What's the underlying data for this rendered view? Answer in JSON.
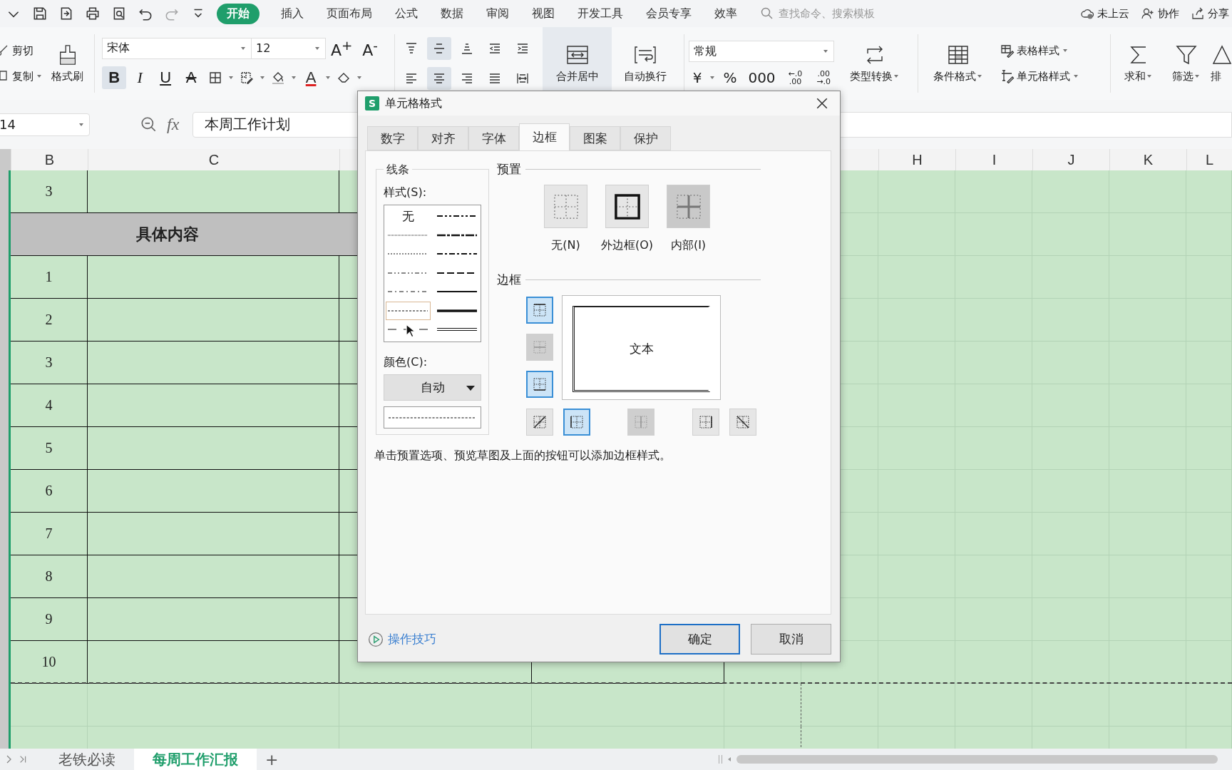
{
  "quick_access": [
    {
      "kind": "chevron",
      "disabled": false
    },
    {
      "kind": "save",
      "disabled": false
    },
    {
      "kind": "export",
      "disabled": false
    },
    {
      "kind": "print",
      "disabled": false
    },
    {
      "kind": "preview",
      "disabled": false
    },
    {
      "kind": "undo",
      "disabled": false
    },
    {
      "kind": "redo",
      "disabled": true
    },
    {
      "kind": "more",
      "disabled": false
    }
  ],
  "menu_tabs": [
    {
      "label": "开始",
      "selected": true
    },
    {
      "label": "插入",
      "selected": false
    },
    {
      "label": "页面布局",
      "selected": false
    },
    {
      "label": "公式",
      "selected": false
    },
    {
      "label": "数据",
      "selected": false
    },
    {
      "label": "审阅",
      "selected": false
    },
    {
      "label": "视图",
      "selected": false
    },
    {
      "label": "开发工具",
      "selected": false
    },
    {
      "label": "会员专享",
      "selected": false
    },
    {
      "label": "效率",
      "selected": false
    }
  ],
  "search": {
    "placeholder": "查找命令、搜索模板"
  },
  "top_actions": [
    {
      "kind": "cloud",
      "label": "未上云"
    },
    {
      "kind": "person",
      "label": "协作"
    },
    {
      "kind": "share",
      "label": "分享"
    }
  ],
  "ribbon": {
    "clipboard": [
      {
        "kind": "cut",
        "label": "剪切"
      },
      {
        "kind": "copy",
        "label": "复制"
      }
    ],
    "painter": "格式刷",
    "font_family": "宋体",
    "font_size": "12",
    "size_buttons": [
      "A$^{+}$",
      "A$^{-}$"
    ],
    "font_tools": [
      {
        "kind": "bold",
        "label": "B",
        "on": true
      },
      {
        "kind": "italic",
        "label": "I",
        "on": false
      },
      {
        "kind": "underline",
        "label": "U",
        "on": false
      },
      {
        "kind": "strike",
        "label": "A",
        "on": false
      },
      {
        "kind": "borders",
        "on": false
      },
      {
        "kind": "cellstyle",
        "on": false
      },
      {
        "kind": "fill",
        "on": false
      },
      {
        "kind": "fontcolor",
        "label": "A",
        "on": false
      },
      {
        "kind": "eraser",
        "on": false
      }
    ],
    "align_rows": [
      [
        {
          "kind": "top",
          "on": false
        },
        {
          "kind": "middle",
          "on": true
        },
        {
          "kind": "bottom",
          "on": false
        },
        {
          "kind": "outdent",
          "on": false
        },
        {
          "kind": "indent",
          "on": false
        }
      ],
      [
        {
          "kind": "left",
          "on": false
        },
        {
          "kind": "center",
          "on": true
        },
        {
          "kind": "right",
          "on": false
        },
        {
          "kind": "justify",
          "on": false
        },
        {
          "kind": "distribute",
          "on": false
        }
      ]
    ],
    "merge": {
      "label": "合并居中",
      "on": true
    },
    "wrap": "自动换行",
    "number_format": "常规",
    "number_tools": [
      {
        "kind": "text",
        "label": "¥"
      },
      {
        "kind": "text",
        "label": "%"
      },
      {
        "kind": "text",
        "label": "000"
      },
      {
        "kind": "decimal",
        "top": "←.0",
        "bottom": ".00"
      },
      {
        "kind": "decimal",
        "top": ".00",
        "bottom": "→.0"
      }
    ],
    "convert": "类型转换",
    "conditional": "条件格式",
    "styles": [
      {
        "kind": "table",
        "label": "表格样式"
      },
      {
        "kind": "cell",
        "label": "单元格样式"
      }
    ],
    "sum": "求和",
    "filter": "筛选",
    "sort": "排"
  },
  "formula_bar": {
    "name_box": "14",
    "fx": "fx",
    "value": "本周工作计划"
  },
  "col_headers": [
    "B",
    "C",
    "H",
    "I",
    "J",
    "K",
    "L"
  ],
  "rows": [
    {
      "kind": "number",
      "value": "3"
    },
    {
      "kind": "section",
      "title": "具体内容"
    },
    {
      "kind": "number",
      "value": "1"
    },
    {
      "kind": "number",
      "value": "2"
    },
    {
      "kind": "number",
      "value": "3"
    },
    {
      "kind": "number",
      "value": "4"
    },
    {
      "kind": "number",
      "value": "5"
    },
    {
      "kind": "number",
      "value": "6"
    },
    {
      "kind": "number",
      "value": "7"
    },
    {
      "kind": "number",
      "value": "8"
    },
    {
      "kind": "number",
      "value": "9"
    },
    {
      "kind": "number",
      "value": "10"
    }
  ],
  "dialog": {
    "icon_label": "S",
    "title": "单元格格式",
    "tabs": [
      {
        "label": "数字",
        "selected": false
      },
      {
        "label": "对齐",
        "selected": false
      },
      {
        "label": "字体",
        "selected": false
      },
      {
        "label": "边框",
        "selected": true
      },
      {
        "label": "图案",
        "selected": false
      },
      {
        "label": "保护",
        "selected": false
      }
    ],
    "line_group": "线条",
    "style_label": "样式(S):",
    "line_styles": [
      {
        "kind": "none",
        "label": "无",
        "selected": false
      },
      {
        "kind": "m-dashdotdot",
        "selected": false
      },
      {
        "kind": "hair",
        "selected": false
      },
      {
        "kind": "slant",
        "selected": false
      },
      {
        "kind": "dotted",
        "selected": false
      },
      {
        "kind": "m-dashdot",
        "selected": false
      },
      {
        "kind": "dashdotdot",
        "selected": false
      },
      {
        "kind": "m-dashed",
        "selected": false
      },
      {
        "kind": "dashdot",
        "selected": false
      },
      {
        "kind": "medium",
        "selected": false
      },
      {
        "kind": "dashed",
        "selected": true
      },
      {
        "kind": "thick",
        "selected": false
      },
      {
        "kind": "longdash",
        "selected": false
      },
      {
        "kind": "double",
        "selected": false
      }
    ],
    "color_label": "颜色(C):",
    "color_value": "自动",
    "preset_label": "预置",
    "presets": [
      {
        "kind": "none",
        "label": "无(N)",
        "disabled": false
      },
      {
        "kind": "outline",
        "label": "外边框(O)",
        "disabled": false
      },
      {
        "kind": "inside",
        "label": "内部(I)",
        "disabled": true
      }
    ],
    "border_label": "边框",
    "sample_text": "文本",
    "side_toggles": [
      {
        "kind": "top",
        "selected": true,
        "disabled": false
      },
      {
        "kind": "hmid",
        "selected": false,
        "disabled": true
      },
      {
        "kind": "bottom",
        "selected": true,
        "disabled": false
      }
    ],
    "bottom_toggles": [
      {
        "kind": "diag-up",
        "selected": false,
        "disabled": false
      },
      {
        "kind": "left",
        "selected": true,
        "disabled": false
      },
      {
        "kind": "vmid",
        "selected": false,
        "disabled": true
      },
      {
        "kind": "right",
        "selected": false,
        "disabled": false
      },
      {
        "kind": "diag-down",
        "selected": false,
        "disabled": false
      }
    ],
    "hint": "单击预置选项、预览草图及上面的按钮可以添加边框样式。",
    "tips_link": "操作技巧",
    "ok": "确定",
    "cancel": "取消"
  },
  "sheet_tabs": [
    {
      "label": "老铁必读",
      "selected": false
    },
    {
      "label": "每周工作汇报",
      "selected": true
    }
  ],
  "add_sheet": "+"
}
